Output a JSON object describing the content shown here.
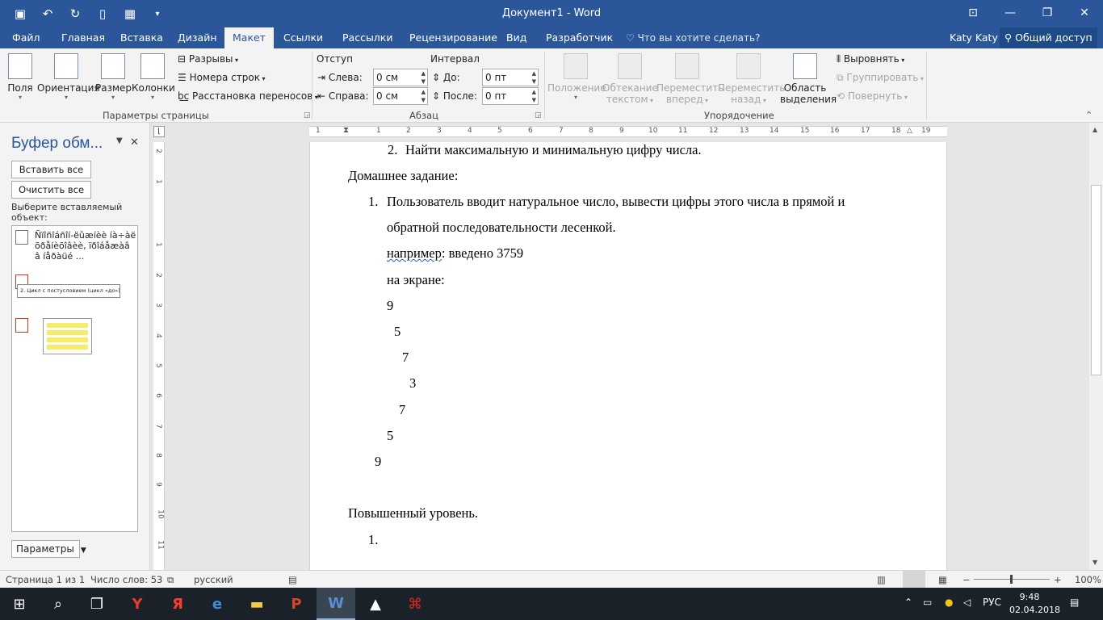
{
  "window": {
    "title": "Документ1 - Word",
    "qat": [
      "save-icon",
      "undo-icon",
      "redo-icon",
      "new-doc-icon",
      "quick-icon",
      "customize-icon"
    ],
    "controls": [
      "restore-ribbon-icon",
      "minimize-icon",
      "maximize-icon",
      "close-icon"
    ]
  },
  "tabs": [
    {
      "label": "Файл"
    },
    {
      "label": "Главная"
    },
    {
      "label": "Вставка"
    },
    {
      "label": "Дизайн"
    },
    {
      "label": "Макет"
    },
    {
      "label": "Ссылки"
    },
    {
      "label": "Рассылки"
    },
    {
      "label": "Рецензирование"
    },
    {
      "label": "Вид"
    },
    {
      "label": "Разработчик"
    }
  ],
  "tell_me": "Что вы хотите сделать?",
  "user": "Katy Katy",
  "share": "Общий доступ",
  "ribbon": {
    "page_setup": {
      "fields": "Поля",
      "orientation": "Ориентация",
      "size": "Размер",
      "columns": "Колонки",
      "breaks": "Разрывы",
      "line_numbers": "Номера строк",
      "hyphenation": "Расстановка переносов",
      "group_label": "Параметры страницы"
    },
    "paragraph": {
      "indent_label": "Отступ",
      "spacing_label": "Интервал",
      "left_label": "Слева:",
      "left_value": "0 см",
      "right_label": "Справа:",
      "right_value": "0 см",
      "before_label": "До:",
      "before_value": "0 пт",
      "after_label": "После:",
      "after_value": "0 пт",
      "group_label": "Абзац"
    },
    "arrange": {
      "position_1": "Положение",
      "wrap_1": "Обтекание",
      "wrap_2": "текстом",
      "forward_1": "Переместить",
      "forward_2": "вперед",
      "backward_1": "Переместить",
      "backward_2": "назад",
      "selection_1": "Область",
      "selection_2": "выделения",
      "align": "Выровнять",
      "group": "Группировать",
      "rotate": "Повернуть",
      "group_label": "Упорядочение"
    }
  },
  "clipboard": {
    "title": "Буфер обм...",
    "paste_all": "Вставить все",
    "clear_all": "Очистить все",
    "hint_1": "Выберите вставляемый",
    "hint_2": "объект:",
    "item1": "Ñïîñîáñîí-ëûæíèè íà÷àë õðåíèõîâèè, ïðîáåæàâ â íåðàüé ...",
    "item2": "2. Цикл с постусловием (цикл «до»)",
    "params": "Параметры"
  },
  "document": {
    "line1_num": "2.",
    "line1": "Найти максимальную и минимальную цифру числа.",
    "homework": "Домашнее задание:",
    "item1_num": "1.",
    "item1_a": "Пользователь вводит натуральное число, вывести цифры этого числа в прямой и",
    "item1_b": "обратной последовательности лесенкой.",
    "example_word": "например",
    "example_rest": ": введено 3759",
    "on_screen": "на экране:",
    "digits": [
      "9",
      "5",
      "7",
      "3",
      "7",
      "5",
      "9"
    ],
    "advanced": "Повышенный уровень.",
    "adv_num": "1."
  },
  "ruler": {
    "h": [
      "1",
      "1",
      "2",
      "3",
      "4",
      "5",
      "6",
      "7",
      "8",
      "9",
      "10",
      "11",
      "12",
      "13",
      "14",
      "15",
      "16",
      "17",
      "18",
      "19"
    ],
    "v": [
      "2",
      "1",
      "1",
      "2",
      "3",
      "4",
      "5",
      "6",
      "7",
      "8",
      "9",
      "10",
      "11",
      "12",
      "13",
      "14",
      "15"
    ]
  },
  "status": {
    "page": "Страница 1 из 1",
    "words": "Число слов: 53",
    "lang": "русский",
    "zoom": "100%"
  },
  "taskbar": {
    "lang": "РУС",
    "time": "9:48",
    "date": "02.04.2018"
  }
}
